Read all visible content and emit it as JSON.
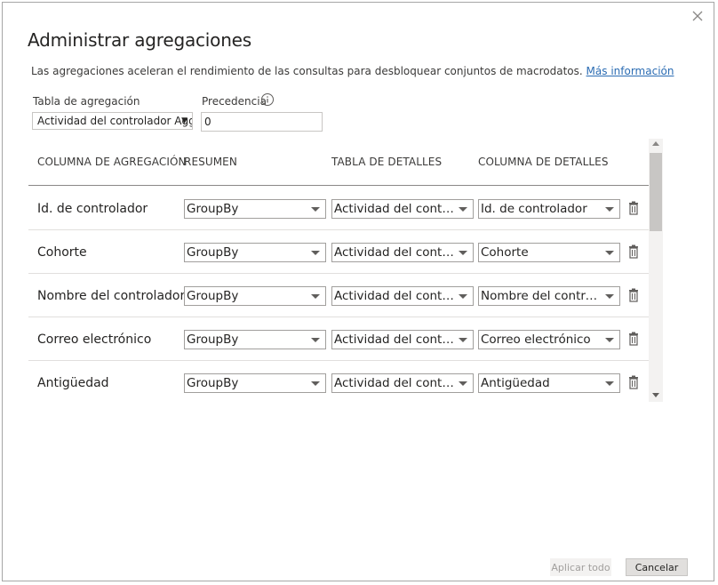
{
  "dialog": {
    "title": "Administrar agregaciones",
    "description": "Las agregaciones aceleran el rendimiento de las consultas para desbloquear conjuntos de macrodatos.",
    "learn_more": "Más información",
    "close_icon": "close-icon"
  },
  "settings": {
    "agg_table_label": "Tabla de agregación",
    "agg_table_value": "Actividad del controlador Agg",
    "precedence_label": "Precedencia",
    "precedence_value": "0",
    "info_icon": "info-icon"
  },
  "table": {
    "headers": [
      "COLUMNA DE AGREGACIÓN",
      "RESUMEN",
      "TABLA DE DETALLES",
      "COLUMNA DE DETALLES"
    ],
    "rows": [
      {
        "column": "Id. de controlador",
        "summary": "GroupBy",
        "detail_table": "Actividad del controlador",
        "detail_column": "Id. de controlador"
      },
      {
        "column": "Cohorte",
        "summary": "GroupBy",
        "detail_table": "Actividad del controlador",
        "detail_column": "Cohorte"
      },
      {
        "column": "Nombre del controlador",
        "summary": "GroupBy",
        "detail_table": "Actividad del controlador",
        "detail_column": "Nombre del controlador"
      },
      {
        "column": "Correo electrónico",
        "summary": "GroupBy",
        "detail_table": "Actividad del controlador",
        "detail_column": "Correo electrónico"
      },
      {
        "column": "Antigüedad",
        "summary": "GroupBy",
        "detail_table": "Actividad del controlador",
        "detail_column": "Antigüedad"
      }
    ]
  },
  "footer": {
    "apply_all": "Aplicar todo",
    "cancel": "Cancelar"
  }
}
